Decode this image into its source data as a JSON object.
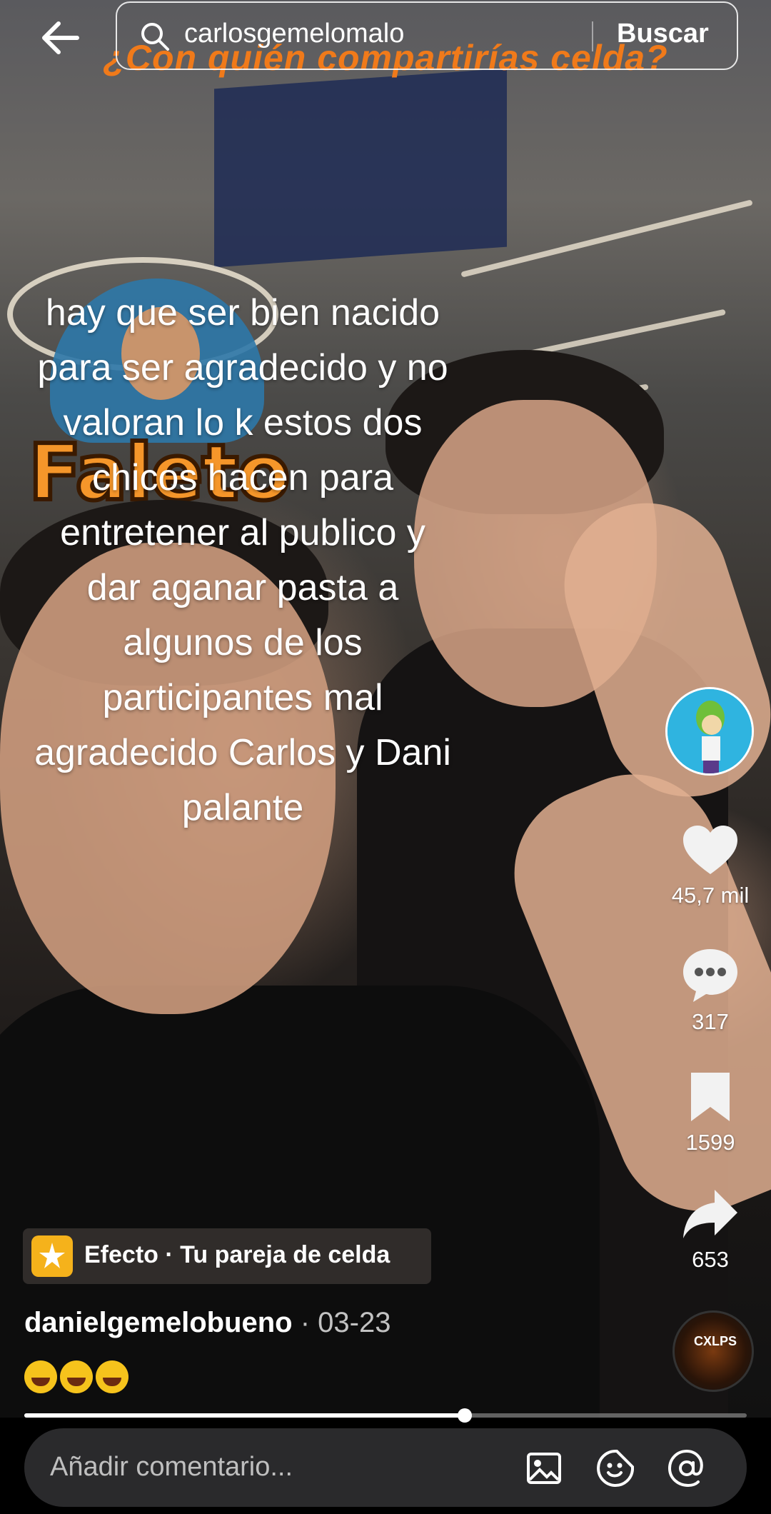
{
  "search": {
    "query": "carlosgemelomalo",
    "button_label": "Buscar"
  },
  "video": {
    "overlay_title": "¿Con quién compartirías celda?",
    "sticker_text": "Faleto",
    "caption": "hay que ser bien nacido para ser agradecido  y no valoran lo k estos dos chicos hacen para entretener al publico y dar aganar pasta a algunos de los participantes  mal agradecido  Carlos y Dani palante"
  },
  "rail": {
    "likes": "45,7 mil",
    "comments": "317",
    "saves": "1599",
    "shares": "653"
  },
  "effect": {
    "label": "Efecto · Tu pareja de celda"
  },
  "post": {
    "author": "danielgemelobueno",
    "date": " · 03-23",
    "emoji_count": 3
  },
  "sound": {
    "disc_label": "CXLPS"
  },
  "progress": {
    "fraction": 0.61
  },
  "comment": {
    "placeholder": "Añadir comentario..."
  },
  "icons": {
    "back": "back-arrow-icon",
    "search": "search-icon",
    "like": "heart-icon",
    "comment": "comment-bubble-icon",
    "save": "bookmark-icon",
    "share": "share-arrow-icon",
    "image": "image-icon",
    "sticker": "sticker-icon",
    "mention": "at-sign-icon"
  },
  "colors": {
    "overlay_title": "#f07a1a",
    "effect_icon": "#f5b21b"
  }
}
